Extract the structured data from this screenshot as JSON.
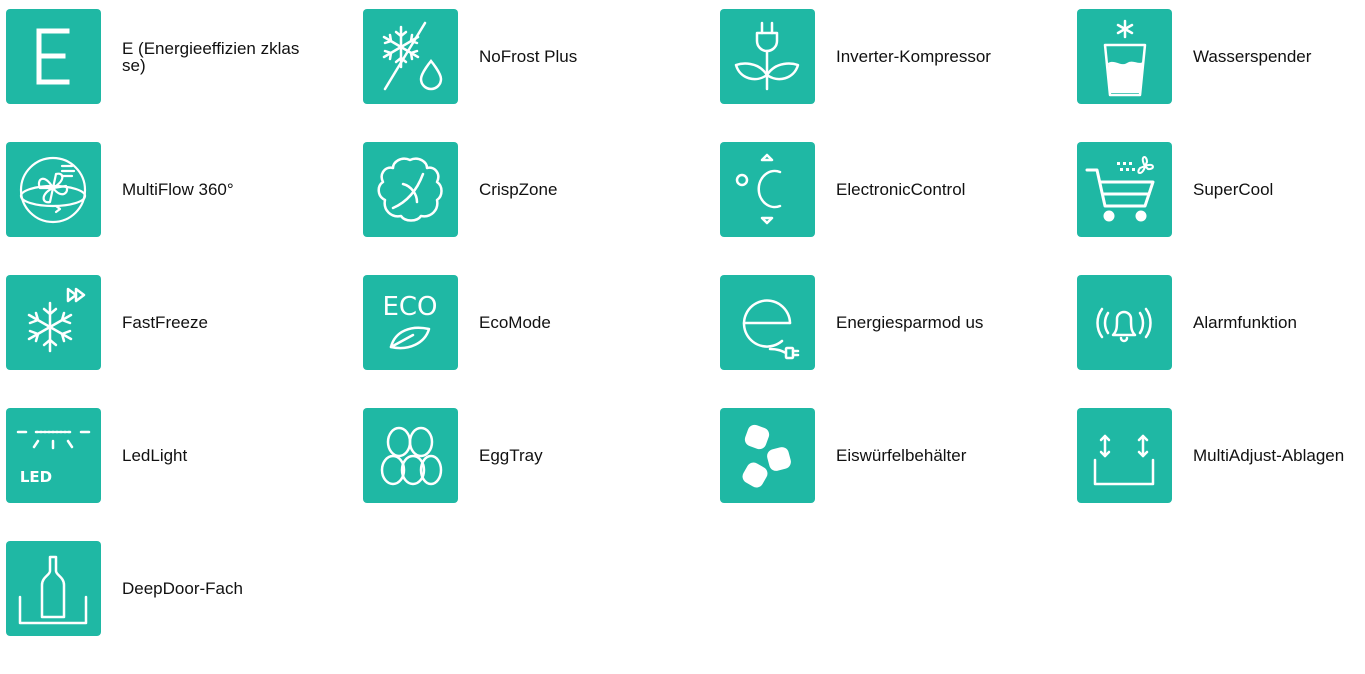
{
  "features": [
    {
      "icon": "energy-class-e-icon",
      "label": "E (Energieeffizien zklasse)"
    },
    {
      "icon": "nofrost-icon",
      "label": "NoFrost Plus"
    },
    {
      "icon": "inverter-compressor-icon",
      "label": "Inverter-Kompressor"
    },
    {
      "icon": "water-dispenser-icon",
      "label": "Wasserspender"
    },
    {
      "icon": "multiflow-icon",
      "label": "MultiFlow 360°"
    },
    {
      "icon": "crispzone-icon",
      "label": "CrispZone"
    },
    {
      "icon": "electronic-control-icon",
      "label": "ElectronicControl"
    },
    {
      "icon": "supercool-icon",
      "label": "SuperCool"
    },
    {
      "icon": "fastfreeze-icon",
      "label": "FastFreeze"
    },
    {
      "icon": "ecomode-icon",
      "label": "EcoMode"
    },
    {
      "icon": "energy-saving-mode-icon",
      "label": "Energiesparmod us"
    },
    {
      "icon": "alarm-icon",
      "label": "Alarmfunktion"
    },
    {
      "icon": "ledlight-icon",
      "label": "LedLight"
    },
    {
      "icon": "eggtray-icon",
      "label": "EggTray"
    },
    {
      "icon": "ice-cube-container-icon",
      "label": "Eiswürfelbehälter"
    },
    {
      "icon": "multiadjust-shelves-icon",
      "label": "MultiAdjust-Ablagen"
    },
    {
      "icon": "deepdoor-icon",
      "label": "DeepDoor-Fach"
    }
  ],
  "colors": {
    "icon_background": "#1fb8a4",
    "icon_foreground": "#ffffff",
    "label_text": "#111111"
  }
}
